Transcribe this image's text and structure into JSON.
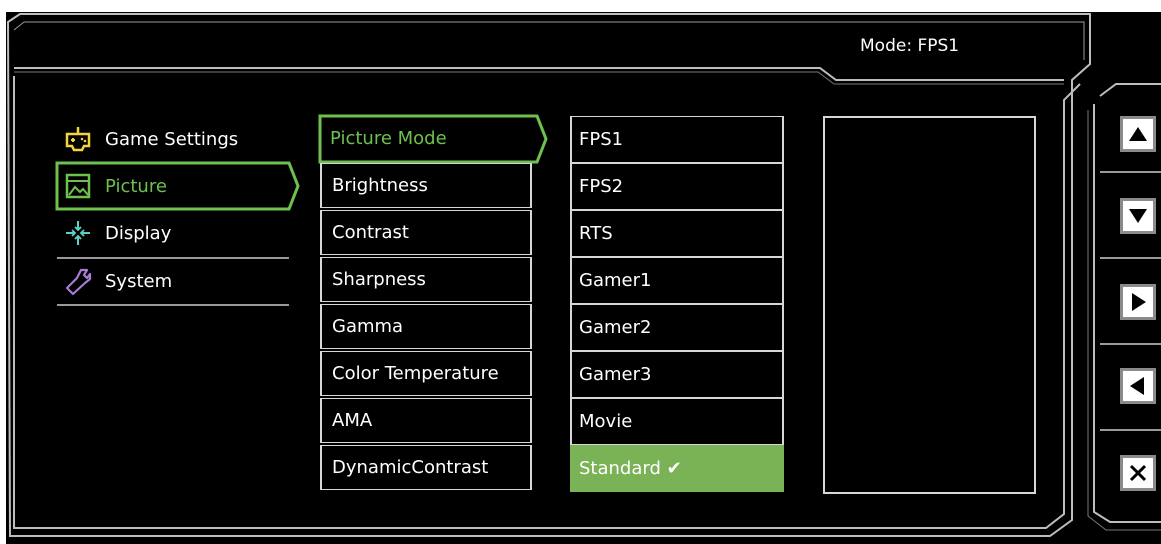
{
  "header": {
    "mode_text": "Mode: FPS1"
  },
  "categories": [
    {
      "label": "Game Settings",
      "icon": "gamepad-icon",
      "selected": false
    },
    {
      "label": "Picture",
      "icon": "picture-icon",
      "selected": true
    },
    {
      "label": "Display",
      "icon": "display-arrows-icon",
      "selected": false
    },
    {
      "label": "System",
      "icon": "wrench-icon",
      "selected": false
    }
  ],
  "submenu": [
    {
      "label": "Picture Mode",
      "selected": true
    },
    {
      "label": "Brightness"
    },
    {
      "label": "Contrast"
    },
    {
      "label": "Sharpness"
    },
    {
      "label": "Gamma"
    },
    {
      "label": "Color Temperature"
    },
    {
      "label": "AMA"
    },
    {
      "label": "DynamicContrast"
    }
  ],
  "options": [
    {
      "label": "FPS1"
    },
    {
      "label": "FPS2"
    },
    {
      "label": "RTS"
    },
    {
      "label": "Gamer1"
    },
    {
      "label": "Gamer2"
    },
    {
      "label": "Gamer3"
    },
    {
      "label": "Movie"
    },
    {
      "label": "Standard ✔",
      "active": true
    }
  ],
  "side_keys": [
    {
      "icon": "arrow-up-icon"
    },
    {
      "icon": "arrow-down-icon"
    },
    {
      "icon": "arrow-right-icon"
    },
    {
      "icon": "arrow-left-icon"
    },
    {
      "icon": "close-icon"
    }
  ],
  "colors": {
    "background": "#000000",
    "accent_green": "#6fc14f",
    "active_option": "#7ab356",
    "border": "#d7d7d7"
  }
}
